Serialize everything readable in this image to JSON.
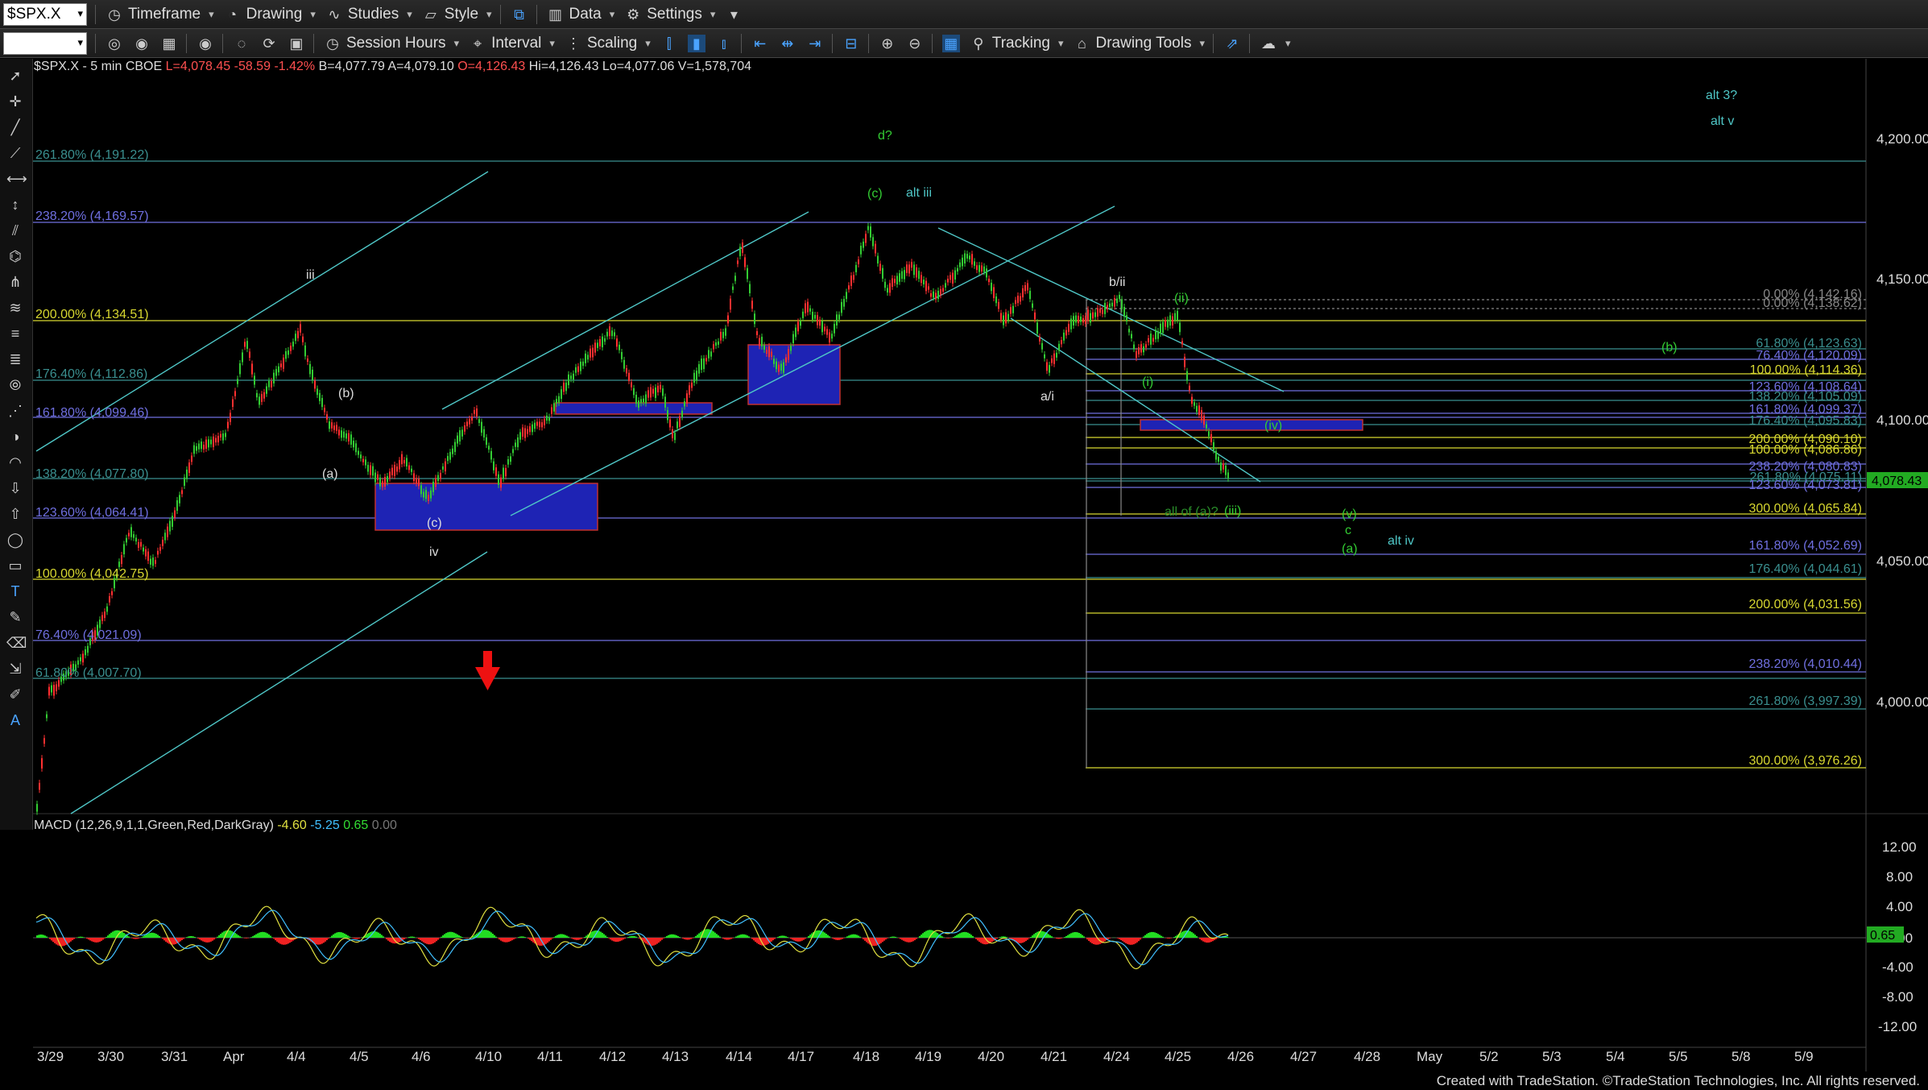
{
  "toolbar1": {
    "symbol": "$SPX.X",
    "timeframe": "Timeframe",
    "drawing": "Drawing",
    "studies": "Studies",
    "style": "Style",
    "data": "Data",
    "settings": "Settings"
  },
  "toolbar2": {
    "session_hours": "Session Hours",
    "interval": "Interval",
    "scaling": "Scaling",
    "tracking": "Tracking",
    "drawing_tools": "Drawing Tools"
  },
  "info_bar": {
    "symbol": "$SPX.X - 5 min",
    "exchange": "CBOE",
    "last": "L=4,078.45",
    "change": "-58.59",
    "change_pct": "-1.42%",
    "bid": "B=4,077.79",
    "ask": "A=4,079.10",
    "open": "O=4,126.43",
    "high": "Hi=4,126.43",
    "low": "Lo=4,077.06",
    "volume": "V=1,578,704"
  },
  "macd_info": {
    "label": "MACD (12,26,9,1,1,Green,Red,DarkGray)",
    "v1": "-4.60",
    "v2": "-5.25",
    "v3": "0.65",
    "v4": "0.00",
    "current": "0.65"
  },
  "price_axis": {
    "labels": [
      "4,200.00",
      "4,150.00",
      "4,100.00",
      "4,050.00",
      "4,000.00"
    ],
    "current_price": "4,078.43"
  },
  "macd_axis": {
    "labels": [
      "12.00",
      "8.00",
      "4.00",
      "0.00",
      "-4.00",
      "-8.00",
      "-12.00"
    ]
  },
  "date_axis": {
    "labels": [
      "3/29",
      "3/30",
      "3/31",
      "Apr",
      "4/4",
      "4/5",
      "4/6",
      "4/10",
      "4/11",
      "4/12",
      "4/13",
      "4/14",
      "4/17",
      "4/18",
      "4/19",
      "4/20",
      "4/21",
      "4/24",
      "4/25",
      "4/26",
      "4/27",
      "4/28",
      "May",
      "5/2",
      "5/3",
      "5/4",
      "5/5",
      "5/8",
      "5/9"
    ]
  },
  "fib_left": {
    "labels": [
      "261.80% (4,191.22)",
      "238.20% (4,169.57)",
      "200.00% (4,134.51)",
      "176.40% (4,112.86)",
      "161.80% (4,099.46)",
      "138.20% (4,077.80)",
      "123.60% (4,064.41)",
      "100.00% (4,042.75)",
      "76.40% (4,021.09)",
      "61.80% (4,007.70)"
    ]
  },
  "fib_right_top": {
    "labels": [
      "0.00% (4,142.16)",
      "0.00% (4,138.62)",
      "61.80% (4,123.63)",
      "76.40% (4,120.09)",
      "100.00% (4,114.36)",
      "123.60% (4,108.64)",
      "138.20% (4,105.09)",
      "161.80% (4,099.37)",
      "176.40% (4,095.83)",
      "200.00% (4,090.10)",
      "100.00% (4,086.86)",
      "238.20% (4,080.83)",
      "261.80% (4,075.11)",
      "123.60% (4,073.81)",
      "300.00% (4,065.84)"
    ]
  },
  "fib_right_bottom": {
    "labels": [
      "161.80% (4,052.69)",
      "176.40% (4,044.61)",
      "200.00% (4,031.56)",
      "238.20% (4,010.44)",
      "261.80% (3,997.39)",
      "300.00% (3,976.26)"
    ]
  },
  "wave_labels": {
    "iii": "iii",
    "b_small": "(b)",
    "a_small": "(a)",
    "c_small": "(c)",
    "iv": "iv",
    "d_q": "d?",
    "c_green": "(c)",
    "alt_iii": "alt iii",
    "b_ii": "b/ii",
    "ii_green": "(ii)",
    "i_green": "(i)",
    "a_i": "a/i",
    "iv_green": "(iv)",
    "b_green": "(b)",
    "all_of_a": "all of (a)?",
    "iii_green": "(iii)",
    "v_green": "(v)",
    "c_plain": "c",
    "a_green": "(a)",
    "alt_iv": "alt iv",
    "alt_3q": "alt 3?",
    "alt_v": "alt v"
  },
  "footer": "Created with TradeStation. ©TradeStation Technologies, Inc. All rights reserved.",
  "colors": {
    "background": "#000000",
    "candle_up": "#33cc33",
    "candle_down": "#ff3030",
    "channel": "#4fc7c7",
    "fib_yellow": "#d8d830",
    "fib_blue": "#6f6fe0",
    "fib_teal": "#3a8f8f",
    "zone_blue": "#1e23b4",
    "macd_pos": "#22dd22",
    "macd_neg": "#ee2222",
    "current_price": "#22aa22"
  }
}
